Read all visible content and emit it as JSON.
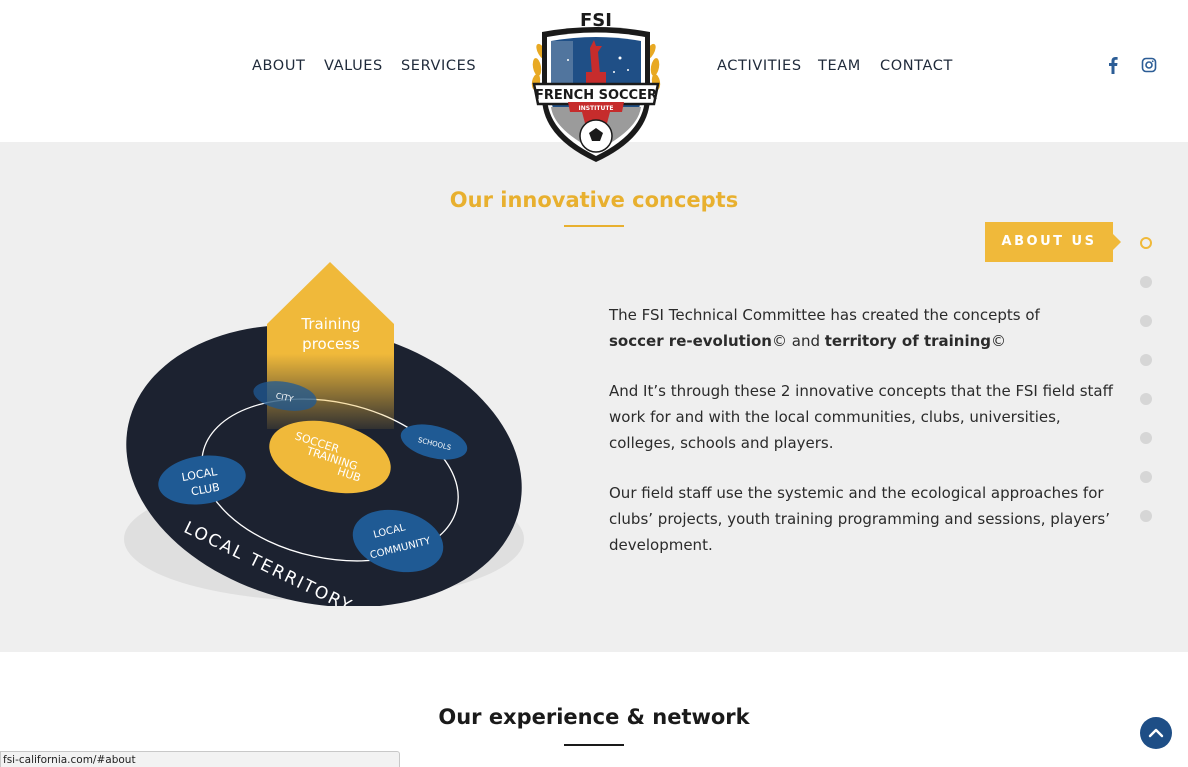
{
  "nav": {
    "left": [
      "ABOUT",
      "VALUES",
      "SERVICES"
    ],
    "right": [
      "ACTIVITIES",
      "TEAM",
      "CONTACT"
    ],
    "social": [
      "facebook-icon",
      "instagram-icon"
    ]
  },
  "logo": {
    "top_text": "FSI",
    "banner_text": "FRENCH SOCCER",
    "sub_text": "INSTITUTE"
  },
  "about": {
    "title": "Our innovative concepts",
    "badge": "ABOUT US",
    "paragraphs": {
      "p1_start": "The FSI Technical Committee has created the concepts of",
      "p1_bold1": "soccer re-evolution",
      "p1_mid": "© and ",
      "p1_bold2": "territory of training",
      "p1_end": "©",
      "p2": "And It’s through these 2 innovative concepts that the FSI field staff work for and with the local communities, clubs, universities, colleges, schools and players.",
      "p3": "Our field staff use the systemic and the ecological approaches for clubs’ projects, youth training programming and sessions, players’ development."
    },
    "diagram": {
      "arrow_label_1": "Training",
      "arrow_label_2": "process",
      "city": "CITY",
      "schools": "SCHOOLS",
      "local_1": "LOCAL",
      "club": "CLUB",
      "local_2": "LOCAL",
      "community": "COMMUNITY",
      "hub_1": "SOCCER",
      "hub_2": "TRAINING",
      "hub_3": "HUB",
      "territory": "LOCAL TERRITORY"
    },
    "dots_count": 8
  },
  "experience": {
    "title": "Our experience & network"
  },
  "status": {
    "url": "fsi-california.com/#about"
  },
  "colors": {
    "accent": "#f0b93a",
    "navy": "#1e4e86",
    "dark": "#1c2230"
  }
}
